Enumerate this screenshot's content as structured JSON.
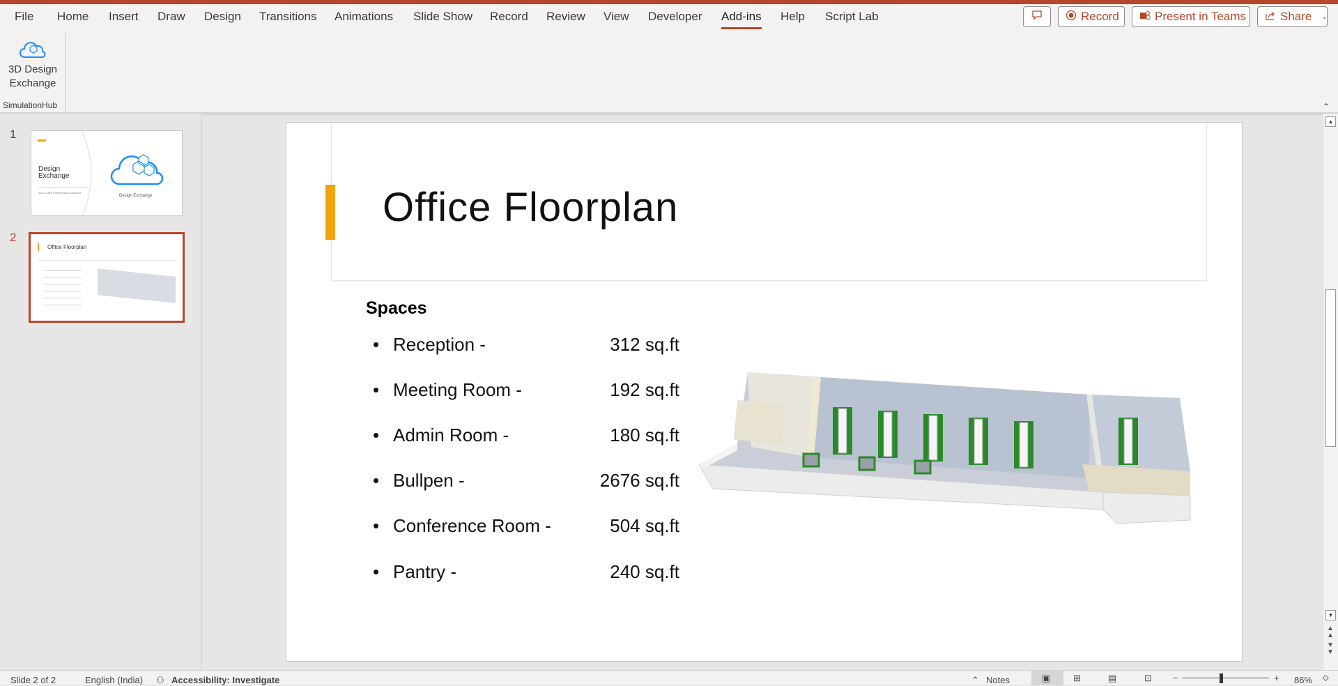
{
  "menu": {
    "tabs": [
      "File",
      "Home",
      "Insert",
      "Draw",
      "Design",
      "Transitions",
      "Animations",
      "Slide Show",
      "Record",
      "Review",
      "View",
      "Developer",
      "Add-ins",
      "Help",
      "Script Lab"
    ],
    "active": "Add-ins"
  },
  "actions": {
    "record": "Record",
    "present": "Present in Teams",
    "share": "Share"
  },
  "ribbon": {
    "button_line1": "3D Design",
    "button_line2": "Exchange",
    "group": "SimulationHub"
  },
  "thumbnails": [
    {
      "number": "1",
      "title_line1": "Design",
      "title_line2": "Exchange",
      "subtitle": "ACC to MS PowerPoint Connector",
      "logo_caption": "Design Exchange"
    },
    {
      "number": "2",
      "title": "Office Floorplan"
    }
  ],
  "slide": {
    "title": "Office Floorplan",
    "heading": "Spaces",
    "items": [
      {
        "label": "Reception -",
        "value": "312 sq.ft"
      },
      {
        "label": "Meeting Room -",
        "value": "192 sq.ft"
      },
      {
        "label": "Admin Room -",
        "value": "180 sq.ft"
      },
      {
        "label": "Bullpen -",
        "value": "2676 sq.ft"
      },
      {
        "label": "Conference Room -",
        "value": "504 sq.ft"
      },
      {
        "label": "Pantry -",
        "value": "240 sq.ft"
      }
    ]
  },
  "status": {
    "slide": "Slide 2 of 2",
    "language": "English (India)",
    "accessibility": "Accessibility: Investigate",
    "notes": "Notes",
    "zoom": "86%"
  },
  "colors": {
    "accent": "#b7472a",
    "title_bar": "#f0a30a",
    "logo_blue": "#1a8cff"
  }
}
